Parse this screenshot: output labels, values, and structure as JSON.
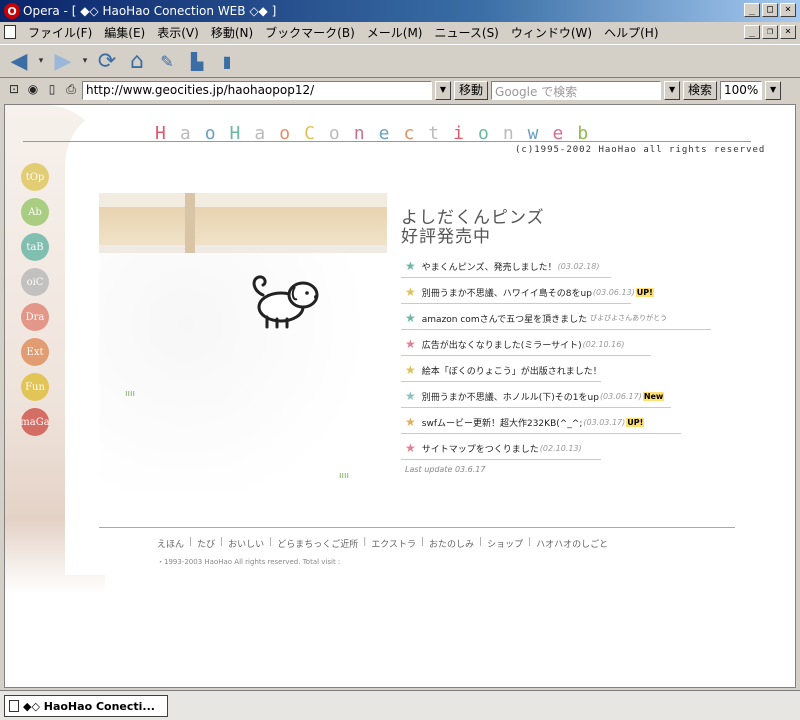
{
  "window": {
    "title": "Opera - [ ◆◇ HaoHao Conection WEB ◇◆ ]",
    "app_icon": "opera-icon"
  },
  "menu": [
    "ファイル(F)",
    "編集(E)",
    "表示(V)",
    "移動(N)",
    "ブックマーク(B)",
    "メール(M)",
    "ニュース(S)",
    "ウィンドウ(W)",
    "ヘルプ(H)"
  ],
  "toolbar": {
    "icons": [
      "back-arrow-icon",
      "forward-arrow-icon",
      "reload-icon",
      "home-icon",
      "bookmarks-icon",
      "print-icon",
      "page-icon"
    ]
  },
  "address": {
    "url": "http://www.geocities.jp/haohaopop12/",
    "go_label": "移動",
    "search_placeholder": "Google で検索",
    "search_label": "検索",
    "zoom": "100%"
  },
  "page": {
    "logo": [
      {
        "ch": "H",
        "color": "#e05a6b"
      },
      {
        "ch": "a",
        "color": "#bbbbbb"
      },
      {
        "ch": "o",
        "color": "#6aa0c0"
      },
      {
        "ch": "H",
        "color": "#6cb8a0"
      },
      {
        "ch": "a",
        "color": "#bbbbbb"
      },
      {
        "ch": "o",
        "color": "#e0906b"
      },
      {
        "ch": " ",
        "color": "#ffffff"
      },
      {
        "ch": "C",
        "color": "#e0c05a"
      },
      {
        "ch": "o",
        "color": "#bbbbbb"
      },
      {
        "ch": "n",
        "color": "#d07090"
      },
      {
        "ch": "e",
        "color": "#6aa0c0"
      },
      {
        "ch": "c",
        "color": "#e0906b"
      },
      {
        "ch": "t",
        "color": "#bbbbbb"
      },
      {
        "ch": "i",
        "color": "#e05a6b"
      },
      {
        "ch": "o",
        "color": "#6cb8a0"
      },
      {
        "ch": "n",
        "color": "#bbbbbb"
      },
      {
        "ch": " ",
        "color": "#ffffff"
      },
      {
        "ch": "w",
        "color": "#6aa0c0"
      },
      {
        "ch": "e",
        "color": "#d07090"
      },
      {
        "ch": "b",
        "color": "#8cba50"
      }
    ],
    "copyright": "(c)1995-2002 HaoHao all rights reserved",
    "nav": [
      {
        "label": "tOp",
        "color": "#e0c860"
      },
      {
        "label": "Ab",
        "color": "#9cc870"
      },
      {
        "label": "taB",
        "color": "#6cb8a8"
      },
      {
        "label": "oiC",
        "color": "#bbbbbb"
      },
      {
        "label": "Dra",
        "color": "#e08a7a"
      },
      {
        "label": "Ext",
        "color": "#e09060"
      },
      {
        "label": "Fun",
        "color": "#e0c040"
      },
      {
        "label": "maGa",
        "color": "#d05a50"
      }
    ],
    "headline_line1": "よしだくんピンズ",
    "headline_line2": "好評発売中",
    "news": [
      {
        "star_color": "#6cb8a0",
        "text": "やまくんピンズ、発売しました！",
        "date": "(03.02.18)",
        "note": "",
        "badge": ""
      },
      {
        "star_color": "#e0c05a",
        "text": "別冊うまか不思議、ハワイイ島その8をup",
        "date": "(03.06.13)",
        "note": "",
        "badge": "UP!"
      },
      {
        "star_color": "#6cb8a0",
        "text": "amazon comさんで五つ星を頂きました",
        "date": "",
        "note": "ぴよぴよさんありがとう",
        "badge": ""
      },
      {
        "star_color": "#e08090",
        "text": "広告が出なくなりました(ミラーサイト)",
        "date": "(02.10.16)",
        "note": "",
        "badge": ""
      },
      {
        "star_color": "#e0c05a",
        "text": "絵本「ぼくのりょこう」が出版されました！",
        "date": "",
        "note": "",
        "badge": ""
      },
      {
        "star_color": "#8cc0c0",
        "text": "別冊うまか不思議、ホノルル(下)その1をup",
        "date": "(03.06.17)",
        "note": "",
        "badge": "New"
      },
      {
        "star_color": "#e0b060",
        "text": "swfムービー更新！超大作232KB(^_^;",
        "date": "(03.03.17)",
        "note": "",
        "badge": "UP!"
      },
      {
        "star_color": "#e08090",
        "text": "サイトマップをつくりました",
        "date": "(02.10.13)",
        "note": "",
        "badge": ""
      }
    ],
    "last_update": "Last update 03.6.17",
    "footer_nav": [
      "えほん",
      "たび",
      "おいしい",
      "どらまちっくご近所",
      "エクストラ",
      "おたのしみ",
      "ショップ",
      "ハオハオのしごと"
    ],
    "footer_copy": "・1993-2003 HaoHao All rights reserved. Total visit :"
  },
  "tab": {
    "title": "◆◇ HaoHao Conecti..."
  }
}
